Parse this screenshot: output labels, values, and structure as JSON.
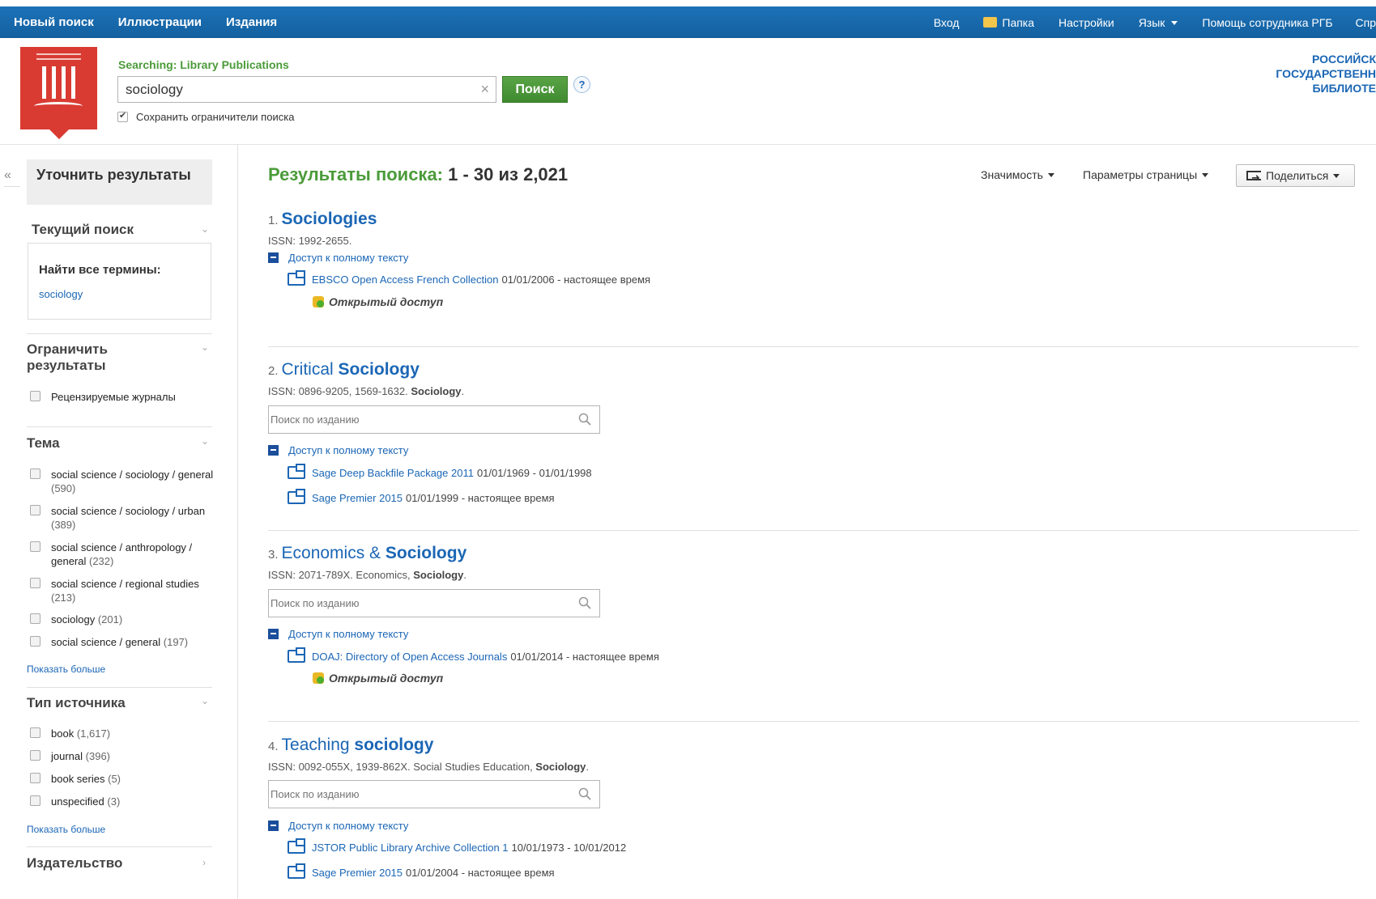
{
  "topnav": {
    "left": [
      "Новый поиск",
      "Иллюстрации",
      "Издания"
    ],
    "signin": "Вход",
    "folder": "Папка",
    "settings": "Настройки",
    "language": "Язык",
    "staff_help": "Помощь сотрудника РГБ",
    "help_cut": "Спр"
  },
  "header": {
    "searching_label": "Searching: Library Publications",
    "query": "sociology",
    "clear": "×",
    "search_button": "Поиск",
    "help": "?",
    "keep_filters": "Сохранить ограничители поиска",
    "library_line1": "РОССИЙСК",
    "library_line2": "ГОСУДАРСТВЕНН",
    "library_line3": "БИБЛИОТЕ"
  },
  "sidebar": {
    "collapse": "«",
    "refine": "Уточнить результаты",
    "current_search": {
      "title": "Текущий поиск",
      "label": "Найти все термины:",
      "term": "sociology"
    },
    "limit": {
      "title": "Ограничить результаты",
      "items": [
        {
          "label": "Рецензируемые журналы",
          "checked": false
        }
      ]
    },
    "subject": {
      "title": "Тема",
      "items": [
        {
          "label": "social science / sociology / general",
          "count": "(590)"
        },
        {
          "label": "social science / sociology / urban",
          "count": "(389)"
        },
        {
          "label": "social science / anthropology / general",
          "count": "(232)"
        },
        {
          "label": "social science / regional studies",
          "count": "(213)"
        },
        {
          "label": "sociology",
          "count": "(201)"
        },
        {
          "label": "social science / general",
          "count": "(197)"
        }
      ],
      "more": "Показать больше"
    },
    "source_type": {
      "title": "Тип источника",
      "items": [
        {
          "label": "book",
          "count": "(1,617)"
        },
        {
          "label": "journal",
          "count": "(396)"
        },
        {
          "label": "book series",
          "count": "(5)"
        },
        {
          "label": "unspecified",
          "count": "(3)"
        }
      ],
      "more": "Показать больше"
    },
    "publisher": {
      "title": "Издательство"
    }
  },
  "results": {
    "heading": "Результаты поиска:",
    "range": "1 - 30 из 2,021",
    "sort": "Значимость",
    "page_options": "Параметры страницы",
    "share": "Поделиться",
    "search_placeholder": "Поиск по изданию",
    "fulltext_label": "Доступ к полному тексту",
    "open_access": "Открытый доступ",
    "items": [
      {
        "num": "1.",
        "title_pre": "",
        "title_bold": "Sociologies",
        "issn": "ISSN: 1992-2655.",
        "subjects_pre": "",
        "subjects_bold": "",
        "links": [
          {
            "name": "EBSCO Open Access French Collection",
            "dates": "01/01/2006 - настоящее время"
          }
        ]
      },
      {
        "num": "2.",
        "title_pre": "Critical ",
        "title_bold": "Sociology",
        "issn": "ISSN: 0896-9205, 1569-1632.",
        "subjects_pre": "",
        "subjects_bold": "Sociology",
        "links": [
          {
            "name": "Sage Deep Backfile Package 2011",
            "dates": "01/01/1969 - 01/01/1998"
          },
          {
            "name": "Sage Premier 2015",
            "dates": "01/01/1999 - настоящее время"
          }
        ]
      },
      {
        "num": "3.",
        "title_pre": "Economics & ",
        "title_bold": "Sociology",
        "issn": "ISSN: 2071-789X.",
        "subjects_pre": "Economics, ",
        "subjects_bold": "Sociology",
        "links": [
          {
            "name": "DOAJ: Directory of Open Access Journals",
            "dates": "01/01/2014 - настоящее время"
          }
        ]
      },
      {
        "num": "4.",
        "title_pre": "Teaching ",
        "title_bold": "sociology",
        "issn": "ISSN: 0092-055X, 1939-862X.",
        "subjects_pre": "Social Studies Education, ",
        "subjects_bold": "Sociology",
        "links": [
          {
            "name": "JSTOR Public Library Archive Collection 1",
            "dates": "10/01/1973 - 10/01/2012"
          },
          {
            "name": "Sage Premier 2015",
            "dates": "01/01/2004 - настоящее время"
          }
        ]
      }
    ]
  }
}
